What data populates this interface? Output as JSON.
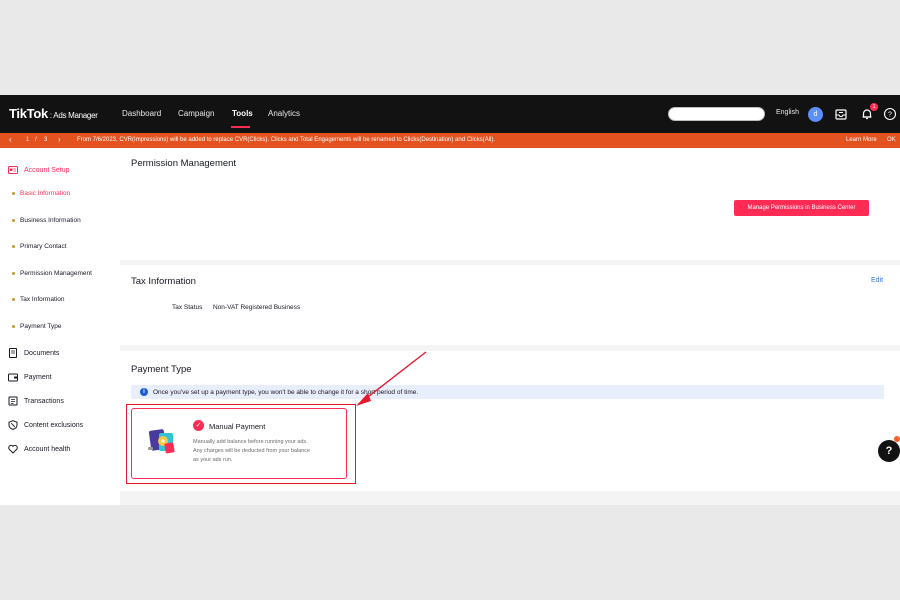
{
  "topnav": {
    "logo": "TikTok",
    "logo_sub": ": Ads Manager",
    "items": [
      "Dashboard",
      "Campaign",
      "Tools",
      "Analytics"
    ],
    "active_item": "Tools",
    "language": "English",
    "avatar_letter": "d",
    "notification_count": "1"
  },
  "banner": {
    "pager_current": "1",
    "pager_sep": "/",
    "pager_total": "3",
    "message": "From 7/6/2023, CVR(Impressions) will be added to replace CVR(Clicks). Clicks and Total Engagements will be renamed to Clicks(Destination) and Clicks(All).",
    "learn_more": "Learn More",
    "ok": "OK"
  },
  "sidebar": {
    "account_setup": "Account Setup",
    "sub_items": [
      "Basic Information",
      "Business Information",
      "Primary Contact",
      "Permission Management",
      "Tax Information",
      "Payment Type"
    ],
    "active_sub": "Basic Information",
    "main_items": [
      "Documents",
      "Payment",
      "Transactions",
      "Content exclusions",
      "Account health"
    ]
  },
  "permission": {
    "title": "Permission Management",
    "button": "Manage Permissions in Business Center"
  },
  "tax": {
    "title": "Tax Information",
    "edit": "Edit",
    "status_label": "Tax Status",
    "status_value": "Non-VAT Registered Business"
  },
  "payment": {
    "title": "Payment Type",
    "notice": "Once you've set up a payment type, you won't be able to change it for a short period of time.",
    "option_name": "Manual Payment",
    "option_desc_1": "Manually add balance before running your ads.",
    "option_desc_2": "Any charges will be deducted from your balance",
    "option_desc_3": "as your ads run."
  },
  "colors": {
    "accent": "#fe2c55",
    "banner": "#e3521f",
    "nav_bg": "#121212",
    "annotation_red": "#e21b2e",
    "link": "#3a73e0"
  }
}
